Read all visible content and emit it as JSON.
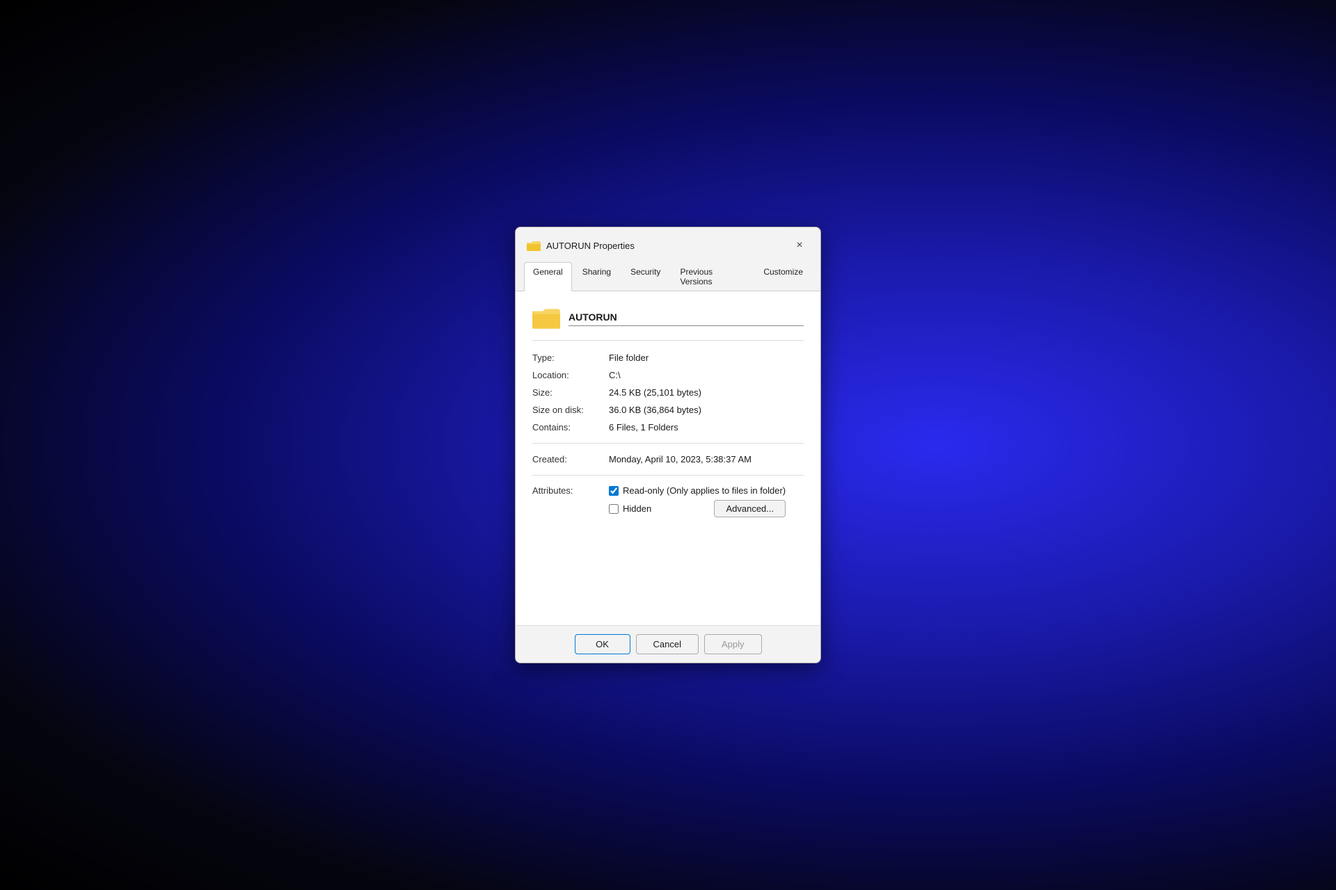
{
  "dialog": {
    "title": "AUTORUN Properties",
    "close_label": "×"
  },
  "tabs": [
    {
      "id": "general",
      "label": "General",
      "active": true
    },
    {
      "id": "sharing",
      "label": "Sharing",
      "active": false
    },
    {
      "id": "security",
      "label": "Security",
      "active": false
    },
    {
      "id": "previous-versions",
      "label": "Previous Versions",
      "active": false
    },
    {
      "id": "customize",
      "label": "Customize",
      "active": false
    }
  ],
  "folder": {
    "name": "AUTORUN"
  },
  "properties": [
    {
      "label": "Type:",
      "value": "File folder"
    },
    {
      "label": "Location:",
      "value": "C:\\"
    },
    {
      "label": "Size:",
      "value": "24.5 KB (25,101 bytes)"
    },
    {
      "label": "Size on disk:",
      "value": "36.0 KB (36,864 bytes)"
    },
    {
      "label": "Contains:",
      "value": "6 Files, 1 Folders"
    }
  ],
  "created": {
    "label": "Created:",
    "value": "Monday, April 10, 2023, 5:38:37 AM"
  },
  "attributes": {
    "label": "Attributes:",
    "readonly_label": "Read-only (Only applies to files in folder)",
    "hidden_label": "Hidden",
    "advanced_label": "Advanced..."
  },
  "footer": {
    "ok_label": "OK",
    "cancel_label": "Cancel",
    "apply_label": "Apply"
  }
}
